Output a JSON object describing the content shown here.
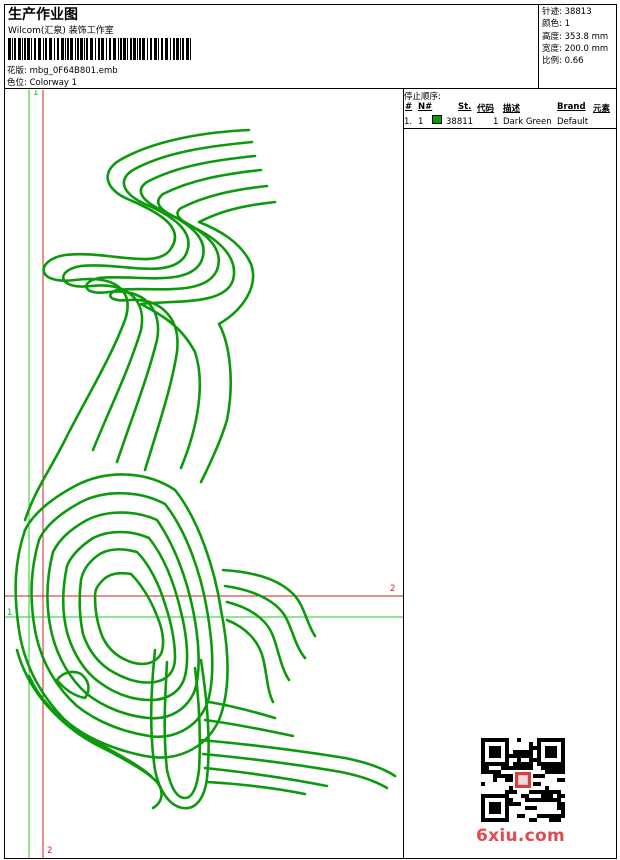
{
  "header": {
    "title": "生产作业图",
    "company": "Wilcom(汇泉) 装饰工作室",
    "design_label": "花版:",
    "design_value": "mbg_0F64B801.emb",
    "colorway_label": "色位:",
    "colorway_value": "Colorway 1"
  },
  "stats": [
    {
      "label": "针迹:",
      "value": "38813"
    },
    {
      "label": "颜色:",
      "value": "1"
    },
    {
      "label": "高度:",
      "value": "353.8 mm"
    },
    {
      "label": "宽度:",
      "value": "200.0 mm"
    },
    {
      "label": "比例:",
      "value": "0.66"
    }
  ],
  "stop_sequence": {
    "title": "停止顺序:",
    "columns": [
      "#",
      "N#",
      "St.",
      "代码",
      "描述",
      "Brand",
      "元素"
    ],
    "rows": [
      {
        "num": "1.",
        "n": "1",
        "color": "#0c9a0c",
        "stitches": "38811",
        "code": "1",
        "description": "Dark Green",
        "brand": "Default"
      }
    ]
  },
  "guides": {
    "vertical_green_label": "1",
    "horizontal_green_label": "1",
    "horizontal_red_label": "2",
    "vertical_red_label": "2"
  },
  "thread_color": "#0c9a0c",
  "watermark": "6xiu.com"
}
